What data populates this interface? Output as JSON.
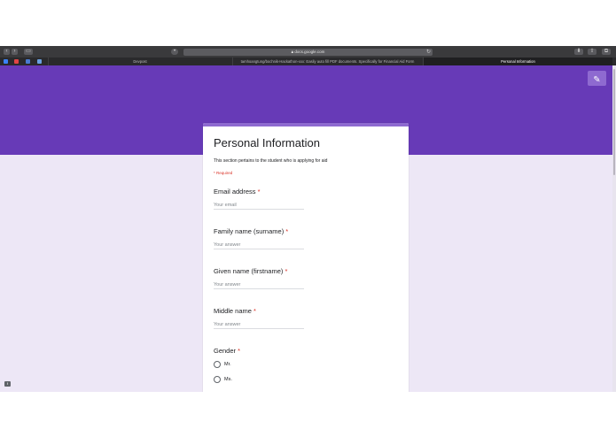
{
  "browser": {
    "url": "docs.google.com",
    "tabs": [
      {
        "label": "Devpost"
      },
      {
        "label": "tamhoangtung/bochnik-Hackathon-xxx: Easily auto fill PDF documents. Specifically for Financial Aid Form"
      },
      {
        "label": "Personal Information"
      }
    ]
  },
  "form": {
    "title": "Personal Information",
    "description": "This section pertains to the student who is applying for aid",
    "required_note": "* Required",
    "required_marker": "*",
    "questions": [
      {
        "label": "Email address",
        "placeholder": "Your email"
      },
      {
        "label": "Family name (surname)",
        "placeholder": "Your answer"
      },
      {
        "label": "Given name (firstname)",
        "placeholder": "Your answer"
      },
      {
        "label": "Middle name",
        "placeholder": "Your answer"
      }
    ],
    "gender": {
      "label": "Gender",
      "options": [
        "Mr.",
        "Ms."
      ]
    }
  },
  "colors": {
    "banner": "#673ab7",
    "background": "#ede7f6",
    "required": "#d93025"
  },
  "icons": [
    "back-icon",
    "forward-icon",
    "sidebar-icon",
    "extension-icon",
    "lock-icon",
    "reload-icon",
    "download-icon",
    "share-icon",
    "new-tab-icon",
    "edit-pencil-icon",
    "feedback-icon"
  ]
}
